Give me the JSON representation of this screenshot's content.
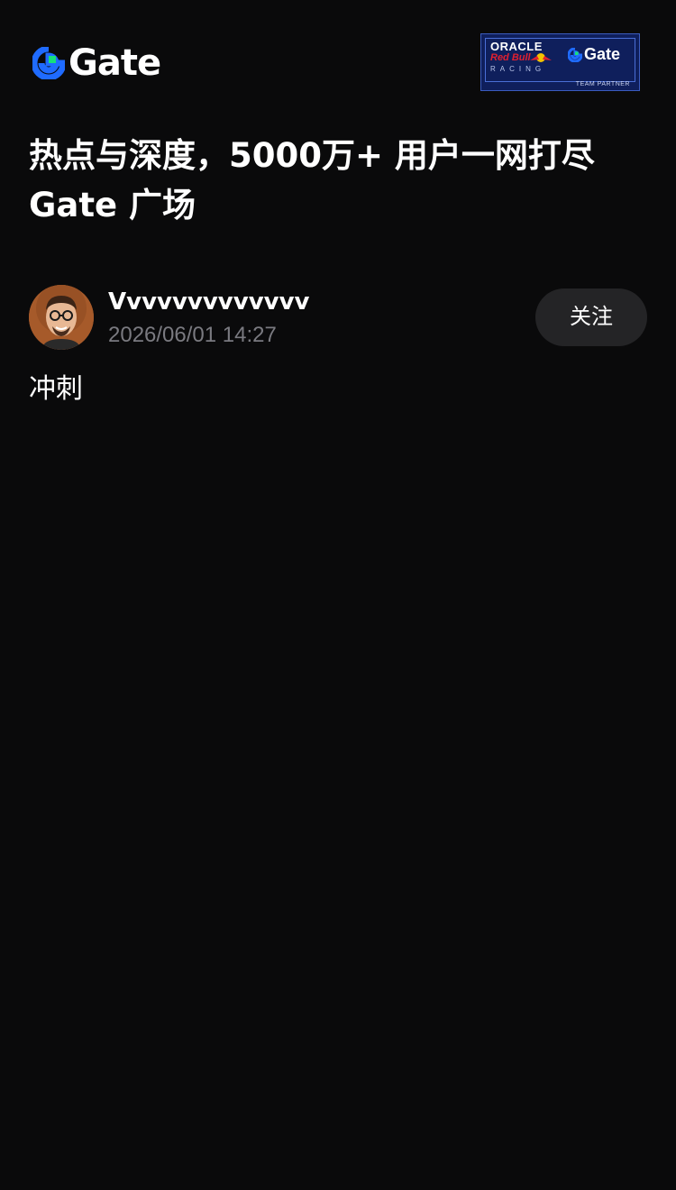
{
  "header": {
    "logo_text": "Gate",
    "partner": {
      "oracle": "ORACLE",
      "redbull": "Red Bull",
      "racing": "RACING",
      "gate": "Gate",
      "team_partner": "TEAM PARTNER"
    }
  },
  "headline": {
    "line1": "热点与深度，5000万+ 用户一网打尽",
    "line2": "Gate 广场"
  },
  "post": {
    "author": "Vvvvvvvvvvvvv",
    "time": "2026/06/01 14:27",
    "follow_label": "关注",
    "content": "冲刺"
  },
  "colors": {
    "background": "#0a0a0b",
    "brand_blue": "#1f6bff",
    "brand_green": "#17e07a",
    "muted_text": "#7a7a80",
    "button_bg": "#242426"
  },
  "icons": {
    "logo": "gate-logo-icon",
    "avatar": "user-avatar"
  }
}
